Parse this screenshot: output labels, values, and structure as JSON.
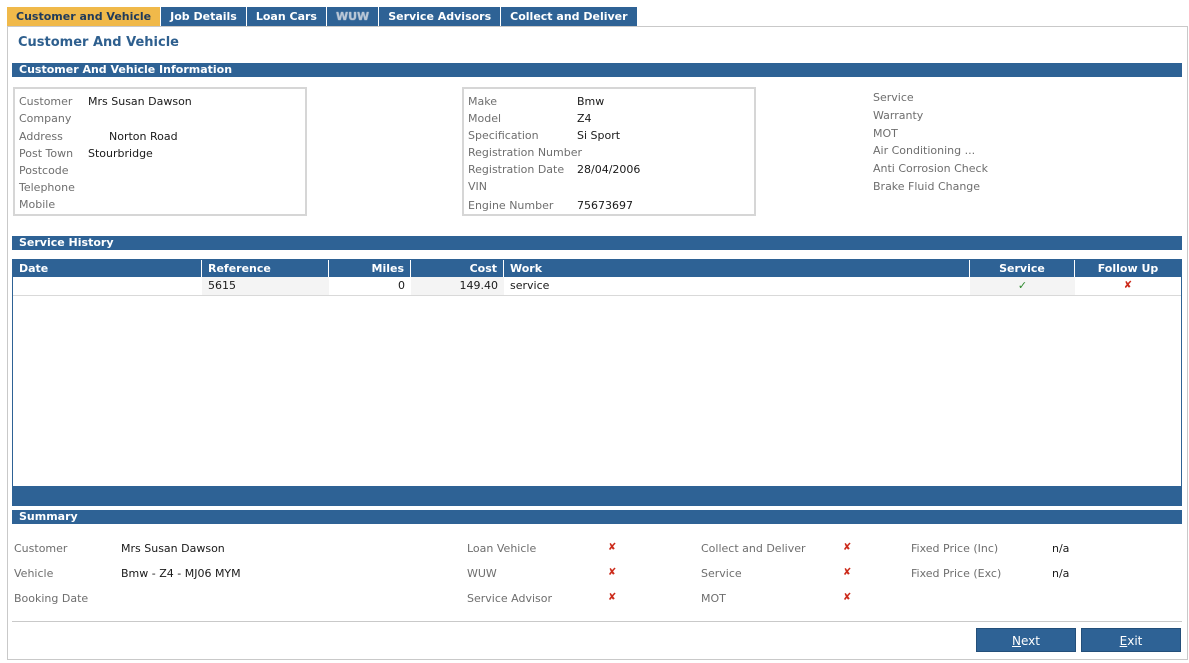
{
  "tabs": [
    {
      "label": "Customer and Vehicle"
    },
    {
      "label": "Job Details"
    },
    {
      "label": "Loan Cars"
    },
    {
      "label": "WUW"
    },
    {
      "label": "Service Advisors"
    },
    {
      "label": "Collect and Deliver"
    }
  ],
  "page_title": "Customer And Vehicle",
  "info_header": "Customer And Vehicle Information",
  "customer": {
    "customer_label": "Customer",
    "customer_value": "Mrs Susan Dawson",
    "company_label": "Company",
    "company_value": "",
    "address_label": "Address",
    "address_value": "Norton Road",
    "post_town_label": "Post Town",
    "post_town_value": "Stourbridge",
    "postcode_label": "Postcode",
    "postcode_value": "",
    "telephone_label": "Telephone",
    "telephone_value": "",
    "mobile_label": "Mobile",
    "mobile_value": ""
  },
  "vehicle": {
    "make_label": "Make",
    "make_value": "Bmw",
    "model_label": "Model",
    "model_value": "Z4",
    "spec_label": "Specification",
    "spec_value": "Si Sport",
    "reg_number_label": "Registration Number",
    "reg_number_value": "",
    "reg_date_label": "Registration Date",
    "reg_date_value": "28/04/2006",
    "vin_label": "VIN",
    "vin_value": "",
    "engine_label": "Engine Number",
    "engine_value": "75673697"
  },
  "due_items": [
    "Service",
    "Warranty",
    "MOT",
    "Air Conditioning ...",
    "Anti Corrosion Check",
    "Brake Fluid Change"
  ],
  "history_header": "Service History",
  "history": {
    "columns": {
      "date": "Date",
      "reference": "Reference",
      "miles": "Miles",
      "cost": "Cost",
      "work": "Work",
      "service": "Service",
      "follow_up": "Follow Up"
    },
    "rows": [
      {
        "date": "",
        "reference": "5615",
        "miles": "0",
        "cost": "149.40",
        "work": "service",
        "service": "✓",
        "follow_up": "✘"
      }
    ]
  },
  "summary_header": "Summary",
  "summary": {
    "customer_label": "Customer",
    "customer_value": "Mrs Susan Dawson",
    "vehicle_label": "Vehicle",
    "vehicle_value": "Bmw - Z4 - MJ06 MYM",
    "booking_label": "Booking Date",
    "booking_value": "",
    "loan_vehicle_label": "Loan Vehicle",
    "wuw_label": "WUW",
    "service_advisor_label": "Service Advisor",
    "collect_label": "Collect and Deliver",
    "service_label": "Service",
    "mot_label": "MOT",
    "fixed_inc_label": "Fixed Price (Inc)",
    "fixed_inc_value": "n/a",
    "fixed_exc_label": "Fixed Price (Exc)",
    "fixed_exc_value": "n/a",
    "cross": "✘"
  },
  "buttons": {
    "next_u": "N",
    "next_rest": "ext",
    "exit_u": "E",
    "exit_rest": "xit"
  },
  "colors": {
    "accent": "#2e6295",
    "active_tab": "#f0b94a",
    "cross": "#cc2a1a",
    "check": "#2d8a2d"
  }
}
